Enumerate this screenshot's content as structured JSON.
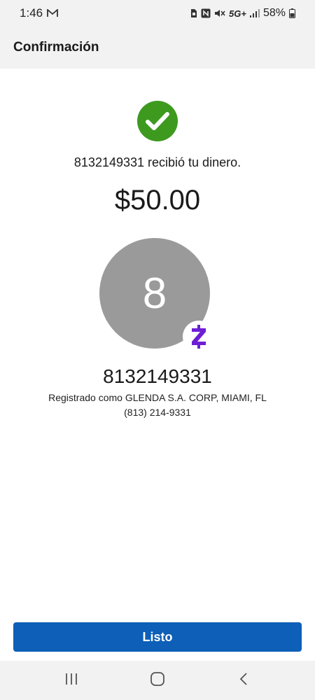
{
  "status_bar": {
    "time": "1:46",
    "network": "5G+",
    "battery": "58%"
  },
  "header": {
    "title": "Confirmación"
  },
  "confirmation": {
    "message": "8132149331 recibió tu dinero.",
    "amount": "$50.00"
  },
  "recipient": {
    "avatar_initial": "8",
    "name": "8132149331",
    "registered_as": "Registrado como GLENDA S.A. CORP, MIAMI, FL",
    "phone": "(813) 214-9331"
  },
  "actions": {
    "done_label": "Listo"
  },
  "colors": {
    "success_green": "#3d9a1f",
    "primary_blue": "#0d5fb8",
    "zelle_purple": "#6d1ed4",
    "avatar_gray": "#9a9a9a"
  },
  "icons": {
    "status_left": [
      "gmail-icon"
    ],
    "status_right": [
      "sim-icon",
      "nfc-icon",
      "mute-icon",
      "signal-icon",
      "battery-icon"
    ],
    "nav": [
      "recents-icon",
      "home-icon",
      "back-icon"
    ]
  }
}
